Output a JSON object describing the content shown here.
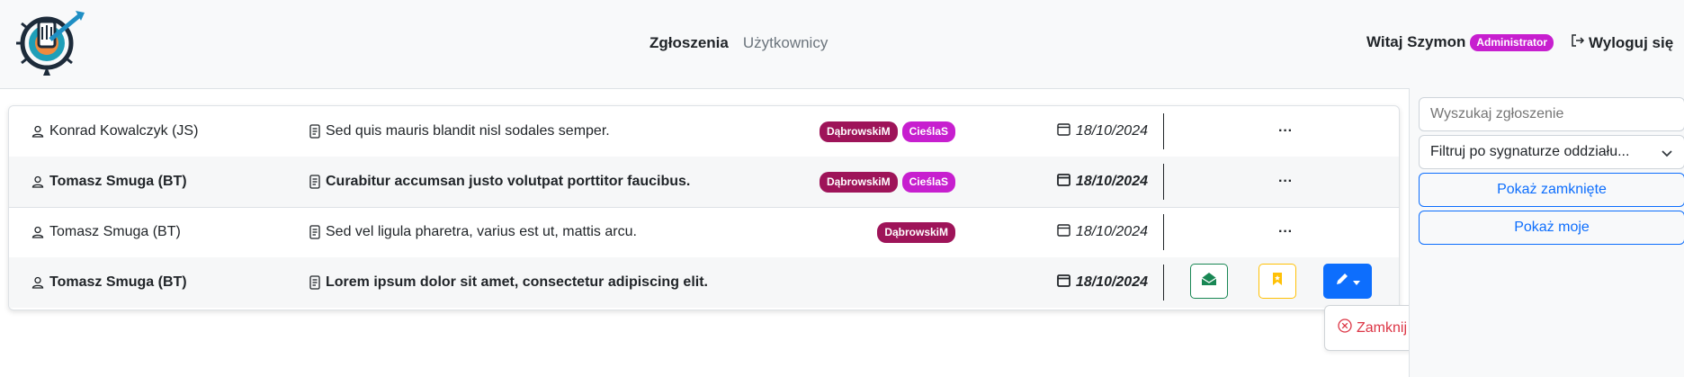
{
  "nav": {
    "links": [
      {
        "label": "Zgłoszenia",
        "active": true
      },
      {
        "label": "Użytkownicy",
        "active": false
      }
    ],
    "greeting": "Witaj Szymon",
    "role_badge": "Administrator",
    "logout_label": "Wyloguj się"
  },
  "tickets": [
    {
      "author": "Konrad Kowalczyk (JS)",
      "title": "Sed quis mauris blandit nisl sodales semper.",
      "tags": [
        "DąbrowskiM",
        "CieślaS"
      ],
      "date": "18/10/2024",
      "bold": false,
      "more": "···"
    },
    {
      "author": "Tomasz Smuga (BT)",
      "title": "Curabitur accumsan justo volutpat porttitor faucibus.",
      "tags": [
        "DąbrowskiM",
        "CieślaS"
      ],
      "date": "18/10/2024",
      "bold": true,
      "more": "···"
    },
    {
      "author": "Tomasz Smuga (BT)",
      "title": "Sed vel ligula pharetra, varius est ut, mattis arcu.",
      "tags": [
        "DąbrowskiM"
      ],
      "date": "18/10/2024",
      "bold": false,
      "more": "···"
    },
    {
      "author": "Tomasz Smuga (BT)",
      "title": "Lorem ipsum dolor sit amet, consectetur adipiscing elit.",
      "tags": [],
      "date": "18/10/2024",
      "bold": true
    }
  ],
  "row_actions": {
    "icons": [
      "envelope-open-icon",
      "bookmark-icon",
      "pencil-icon"
    ]
  },
  "dropdown": {
    "item_label": "Zamknij"
  },
  "sidebar": {
    "search_placeholder": "Wyszukaj zgłoszenie",
    "filter_label": "Filtruj po sygnaturze oddziału...",
    "show_closed_label": "Pokaż zamknięte",
    "show_mine_label": "Pokaż moje"
  },
  "colors": {
    "primary": "#0d6efd",
    "success": "#198754",
    "warning": "#ffc107",
    "danger": "#dc3545",
    "tag_dark": "#9e1459",
    "tag_magenta": "#c71fcf"
  }
}
